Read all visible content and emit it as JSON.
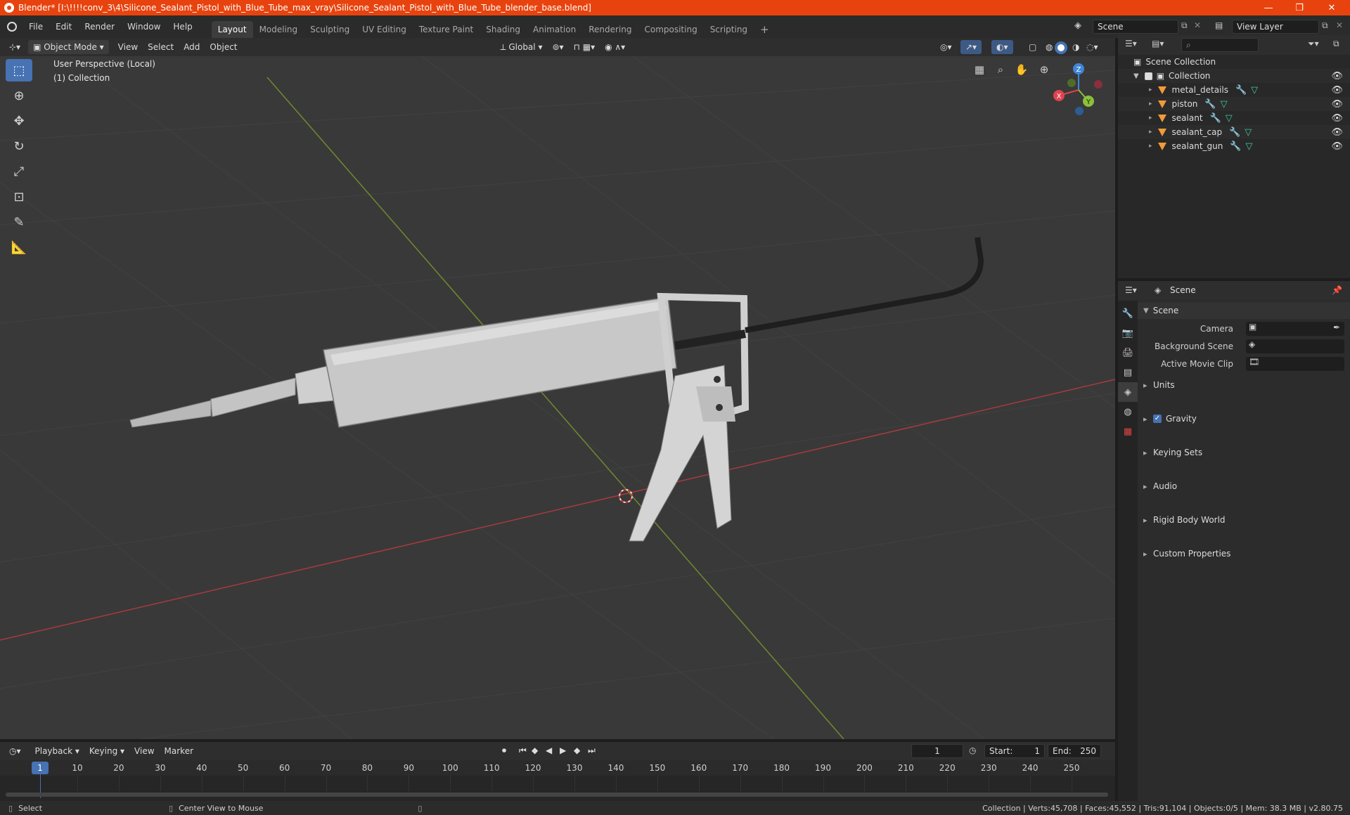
{
  "window": {
    "title": "Blender* [I:\\!!!!conv_3\\4\\Silicone_Sealant_Pistol_with_Blue_Tube_max_vray\\Silicone_Sealant_Pistol_with_Blue_Tube_blender_base.blend]",
    "minimize": "—",
    "maximize": "❐",
    "close": "✕"
  },
  "menu": [
    "File",
    "Edit",
    "Render",
    "Window",
    "Help"
  ],
  "workspaces": [
    "Layout",
    "Modeling",
    "Sculpting",
    "UV Editing",
    "Texture Paint",
    "Shading",
    "Animation",
    "Rendering",
    "Compositing",
    "Scripting"
  ],
  "workspace_add": "+",
  "scene_field": "Scene",
  "view_layer_field": "View Layer",
  "viewport_header": {
    "mode": "Object Mode",
    "menus": [
      "View",
      "Select",
      "Add",
      "Object"
    ],
    "orientation": "Global"
  },
  "viewport": {
    "perspective_label": "User Perspective (Local)",
    "collection_label": "(1) Collection",
    "gizmo": {
      "x": "X",
      "y": "Y",
      "z": "Z"
    }
  },
  "outliner": {
    "search_placeholder": "",
    "scene_collection": "Scene Collection",
    "collection": "Collection",
    "objects": [
      "metal_details",
      "piston",
      "sealant",
      "sealant_cap",
      "sealant_gun"
    ]
  },
  "properties": {
    "header_title": "Scene",
    "section_title": "Scene",
    "fields": [
      {
        "label": "Camera"
      },
      {
        "label": "Background Scene"
      },
      {
        "label": "Active Movie Clip"
      }
    ],
    "panels": [
      "Units",
      "Gravity",
      "Keying Sets",
      "Audio",
      "Rigid Body World",
      "Custom Properties"
    ],
    "gravity_checked": true
  },
  "timeline": {
    "menus": [
      "Playback",
      "Keying",
      "View",
      "Marker"
    ],
    "current_frame": "1",
    "start_label": "Start:",
    "start_value": "1",
    "end_label": "End:",
    "end_value": "250",
    "ticks": [
      "1",
      "10",
      "20",
      "30",
      "40",
      "50",
      "60",
      "70",
      "80",
      "90",
      "100",
      "110",
      "120",
      "130",
      "140",
      "150",
      "160",
      "170",
      "180",
      "190",
      "200",
      "210",
      "220",
      "230",
      "240",
      "250"
    ]
  },
  "statusbar": {
    "select": "Select",
    "center_view": "Center View to Mouse",
    "stats": "Collection | Verts:45,708 | Faces:45,552 | Tris:91,104 | Objects:0/5 | Mem: 38.3 MB | v2.80.75"
  },
  "colors": {
    "title_bar": "#e8430e",
    "accent": "#4772b3",
    "x_axis": "#e0434f",
    "y_axis": "#8bc03b",
    "z_axis": "#3f86d6"
  }
}
